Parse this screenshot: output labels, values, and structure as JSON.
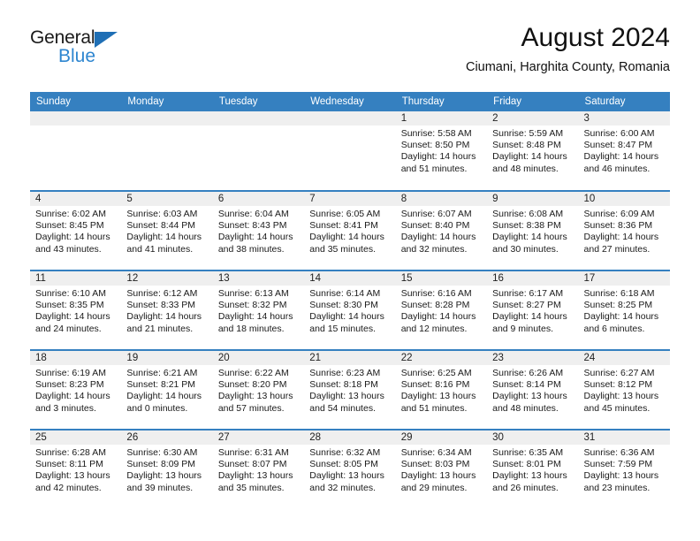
{
  "brand": {
    "name_top": "General",
    "name_bottom": "Blue",
    "accent_color": "#2e86d0",
    "triangle_color": "#1f6fb5"
  },
  "header": {
    "title": "August 2024",
    "subtitle": "Ciumani, Harghita County, Romania",
    "header_bg": "#3580c0",
    "daynum_bg": "#efefef"
  },
  "weekday_headers": [
    "Sunday",
    "Monday",
    "Tuesday",
    "Wednesday",
    "Thursday",
    "Friday",
    "Saturday"
  ],
  "weeks": [
    [
      {
        "day": "",
        "sunrise": "",
        "sunset": "",
        "daylight1": "",
        "daylight2": "",
        "empty": true
      },
      {
        "day": "",
        "sunrise": "",
        "sunset": "",
        "daylight1": "",
        "daylight2": "",
        "empty": true
      },
      {
        "day": "",
        "sunrise": "",
        "sunset": "",
        "daylight1": "",
        "daylight2": "",
        "empty": true
      },
      {
        "day": "",
        "sunrise": "",
        "sunset": "",
        "daylight1": "",
        "daylight2": "",
        "empty": true
      },
      {
        "day": "1",
        "sunrise": "Sunrise: 5:58 AM",
        "sunset": "Sunset: 8:50 PM",
        "daylight1": "Daylight: 14 hours",
        "daylight2": "and 51 minutes."
      },
      {
        "day": "2",
        "sunrise": "Sunrise: 5:59 AM",
        "sunset": "Sunset: 8:48 PM",
        "daylight1": "Daylight: 14 hours",
        "daylight2": "and 48 minutes."
      },
      {
        "day": "3",
        "sunrise": "Sunrise: 6:00 AM",
        "sunset": "Sunset: 8:47 PM",
        "daylight1": "Daylight: 14 hours",
        "daylight2": "and 46 minutes."
      }
    ],
    [
      {
        "day": "4",
        "sunrise": "Sunrise: 6:02 AM",
        "sunset": "Sunset: 8:45 PM",
        "daylight1": "Daylight: 14 hours",
        "daylight2": "and 43 minutes."
      },
      {
        "day": "5",
        "sunrise": "Sunrise: 6:03 AM",
        "sunset": "Sunset: 8:44 PM",
        "daylight1": "Daylight: 14 hours",
        "daylight2": "and 41 minutes."
      },
      {
        "day": "6",
        "sunrise": "Sunrise: 6:04 AM",
        "sunset": "Sunset: 8:43 PM",
        "daylight1": "Daylight: 14 hours",
        "daylight2": "and 38 minutes."
      },
      {
        "day": "7",
        "sunrise": "Sunrise: 6:05 AM",
        "sunset": "Sunset: 8:41 PM",
        "daylight1": "Daylight: 14 hours",
        "daylight2": "and 35 minutes."
      },
      {
        "day": "8",
        "sunrise": "Sunrise: 6:07 AM",
        "sunset": "Sunset: 8:40 PM",
        "daylight1": "Daylight: 14 hours",
        "daylight2": "and 32 minutes."
      },
      {
        "day": "9",
        "sunrise": "Sunrise: 6:08 AM",
        "sunset": "Sunset: 8:38 PM",
        "daylight1": "Daylight: 14 hours",
        "daylight2": "and 30 minutes."
      },
      {
        "day": "10",
        "sunrise": "Sunrise: 6:09 AM",
        "sunset": "Sunset: 8:36 PM",
        "daylight1": "Daylight: 14 hours",
        "daylight2": "and 27 minutes."
      }
    ],
    [
      {
        "day": "11",
        "sunrise": "Sunrise: 6:10 AM",
        "sunset": "Sunset: 8:35 PM",
        "daylight1": "Daylight: 14 hours",
        "daylight2": "and 24 minutes."
      },
      {
        "day": "12",
        "sunrise": "Sunrise: 6:12 AM",
        "sunset": "Sunset: 8:33 PM",
        "daylight1": "Daylight: 14 hours",
        "daylight2": "and 21 minutes."
      },
      {
        "day": "13",
        "sunrise": "Sunrise: 6:13 AM",
        "sunset": "Sunset: 8:32 PM",
        "daylight1": "Daylight: 14 hours",
        "daylight2": "and 18 minutes."
      },
      {
        "day": "14",
        "sunrise": "Sunrise: 6:14 AM",
        "sunset": "Sunset: 8:30 PM",
        "daylight1": "Daylight: 14 hours",
        "daylight2": "and 15 minutes."
      },
      {
        "day": "15",
        "sunrise": "Sunrise: 6:16 AM",
        "sunset": "Sunset: 8:28 PM",
        "daylight1": "Daylight: 14 hours",
        "daylight2": "and 12 minutes."
      },
      {
        "day": "16",
        "sunrise": "Sunrise: 6:17 AM",
        "sunset": "Sunset: 8:27 PM",
        "daylight1": "Daylight: 14 hours",
        "daylight2": "and 9 minutes."
      },
      {
        "day": "17",
        "sunrise": "Sunrise: 6:18 AM",
        "sunset": "Sunset: 8:25 PM",
        "daylight1": "Daylight: 14 hours",
        "daylight2": "and 6 minutes."
      }
    ],
    [
      {
        "day": "18",
        "sunrise": "Sunrise: 6:19 AM",
        "sunset": "Sunset: 8:23 PM",
        "daylight1": "Daylight: 14 hours",
        "daylight2": "and 3 minutes."
      },
      {
        "day": "19",
        "sunrise": "Sunrise: 6:21 AM",
        "sunset": "Sunset: 8:21 PM",
        "daylight1": "Daylight: 14 hours",
        "daylight2": "and 0 minutes."
      },
      {
        "day": "20",
        "sunrise": "Sunrise: 6:22 AM",
        "sunset": "Sunset: 8:20 PM",
        "daylight1": "Daylight: 13 hours",
        "daylight2": "and 57 minutes."
      },
      {
        "day": "21",
        "sunrise": "Sunrise: 6:23 AM",
        "sunset": "Sunset: 8:18 PM",
        "daylight1": "Daylight: 13 hours",
        "daylight2": "and 54 minutes."
      },
      {
        "day": "22",
        "sunrise": "Sunrise: 6:25 AM",
        "sunset": "Sunset: 8:16 PM",
        "daylight1": "Daylight: 13 hours",
        "daylight2": "and 51 minutes."
      },
      {
        "day": "23",
        "sunrise": "Sunrise: 6:26 AM",
        "sunset": "Sunset: 8:14 PM",
        "daylight1": "Daylight: 13 hours",
        "daylight2": "and 48 minutes."
      },
      {
        "day": "24",
        "sunrise": "Sunrise: 6:27 AM",
        "sunset": "Sunset: 8:12 PM",
        "daylight1": "Daylight: 13 hours",
        "daylight2": "and 45 minutes."
      }
    ],
    [
      {
        "day": "25",
        "sunrise": "Sunrise: 6:28 AM",
        "sunset": "Sunset: 8:11 PM",
        "daylight1": "Daylight: 13 hours",
        "daylight2": "and 42 minutes."
      },
      {
        "day": "26",
        "sunrise": "Sunrise: 6:30 AM",
        "sunset": "Sunset: 8:09 PM",
        "daylight1": "Daylight: 13 hours",
        "daylight2": "and 39 minutes."
      },
      {
        "day": "27",
        "sunrise": "Sunrise: 6:31 AM",
        "sunset": "Sunset: 8:07 PM",
        "daylight1": "Daylight: 13 hours",
        "daylight2": "and 35 minutes."
      },
      {
        "day": "28",
        "sunrise": "Sunrise: 6:32 AM",
        "sunset": "Sunset: 8:05 PM",
        "daylight1": "Daylight: 13 hours",
        "daylight2": "and 32 minutes."
      },
      {
        "day": "29",
        "sunrise": "Sunrise: 6:34 AM",
        "sunset": "Sunset: 8:03 PM",
        "daylight1": "Daylight: 13 hours",
        "daylight2": "and 29 minutes."
      },
      {
        "day": "30",
        "sunrise": "Sunrise: 6:35 AM",
        "sunset": "Sunset: 8:01 PM",
        "daylight1": "Daylight: 13 hours",
        "daylight2": "and 26 minutes."
      },
      {
        "day": "31",
        "sunrise": "Sunrise: 6:36 AM",
        "sunset": "Sunset: 7:59 PM",
        "daylight1": "Daylight: 13 hours",
        "daylight2": "and 23 minutes."
      }
    ]
  ]
}
